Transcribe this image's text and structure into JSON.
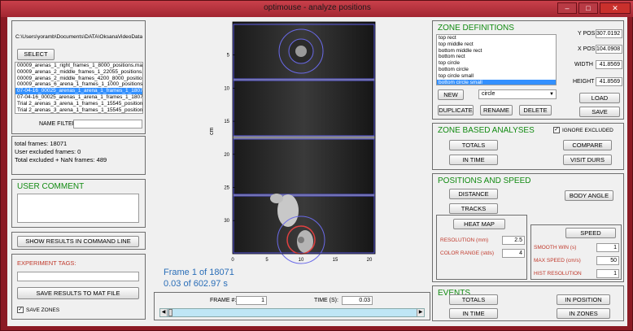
{
  "window": {
    "title": "optimouse - analyze positions",
    "min_icon": "minimize-icon",
    "max_icon": "maximize-icon",
    "close_icon": "close-icon"
  },
  "file_panel": {
    "path": "C:\\Users\\yoramb\\Documents\\DATA\\OksanaVideoData",
    "select_dir": "SELECT DIR",
    "files": [
      "00009_arenas_1_right_frames_1_8000_positions.mat",
      "00009_arenas_2_middle_frames_1_22055_positions.mat",
      "00009_arenas_2_middle_frames_4200_8000_positions.mat",
      "00009_arenas_6_arena_1_frames_1_1000_positions.mat",
      "07-04-16_00025_arenas_1_arena_1_frames_1_18071_positions.mat",
      "07-04-16_00025_arenas_1_arena_1_frames_1_18071_positions",
      "Trial     2_arenas_3_arena_1_frames_1_15545_positions",
      "Trial     2_arenas_3_arena_1_frames_1_15545_positions"
    ],
    "selected_index": 4,
    "name_filter_label": "NAME FILTER",
    "name_filter_value": ""
  },
  "stats": {
    "total_frames": "total frames: 18071",
    "user_excluded": "User excluded frames: 0",
    "total_excluded": "Total excluded + NaN frames: 489"
  },
  "user_comment": {
    "title": "USER COMMENT",
    "value": ""
  },
  "show_results_btn": "SHOW RESULTS IN COMMAND LINE",
  "experiment": {
    "tags_label": "EXPERIMENT TAGS:",
    "tags_value": "",
    "save_mat": "SAVE RESULTS TO MAT FILE",
    "save_zones": "SAVE ZONES",
    "save_zones_checked": true
  },
  "plot": {
    "ylabel": "cm",
    "yticks": [
      "5",
      "10",
      "15",
      "20",
      "25",
      "30"
    ],
    "xticks": [
      "0",
      "5",
      "10",
      "15",
      "20"
    ],
    "frame_text": "Frame 1 of 18071",
    "time_text": "0.03 of 602.97 s"
  },
  "frame_ctrl": {
    "frame_label": "FRAME #:",
    "frame_value": "1",
    "time_label": "TIME (S):",
    "time_value": "0.03",
    "slider_position": 0
  },
  "zones": {
    "title": "ZONE DEFINITIONS",
    "items": [
      "top rect",
      "top middle rect",
      "bottom middle rect",
      "bottom rect",
      "top circle",
      "bottom circle",
      "top circle small",
      "bottom circle small"
    ],
    "selected_index": 7,
    "new": "NEW",
    "shape_value": "circle",
    "duplicate": "DUPLICATE",
    "rename": "RENAME",
    "delete": "DELETE",
    "ypos_label": "Y POS",
    "ypos": "307.0192",
    "xpos_label": "X POS",
    "xpos": "104.0908",
    "width_label": "WIDTH",
    "width": "41.8569",
    "height_label": "HEIGHT",
    "height": "41.8569",
    "load": "LOAD",
    "save": "SAVE"
  },
  "zone_analyses": {
    "title": "ZONE BASED ANALYSES",
    "ignore_excluded": "IGNORE EXCLUDED",
    "ignore_checked": true,
    "totals": "TOTALS",
    "compare": "COMPARE",
    "in_time": "IN TIME",
    "visit_durs": "VISIT DURS"
  },
  "positions": {
    "title": "POSITIONS AND SPEED",
    "distance": "DISTANCE",
    "body_angle": "BODY ANGLE",
    "tracks": "TRACKS",
    "heat_map": "HEAT MAP",
    "speed": "SPEED",
    "resolution_label": "RESOLUTION (mm)",
    "resolution": "2.5",
    "color_range_label": "COLOR RANGE (stds)",
    "color_range": "4",
    "smooth_win_label": "SMOOTH WIN (s)",
    "smooth_win": "1",
    "max_speed_label": "MAX SPEED (cm/s)",
    "max_speed": "50",
    "hist_res_label": "HIST RESOLUTION",
    "hist_res": "1"
  },
  "events": {
    "title": "EVENTS",
    "totals": "TOTALS",
    "in_position": "IN POSITION",
    "in_time": "IN TIME",
    "in_zones": "IN ZONES"
  }
}
